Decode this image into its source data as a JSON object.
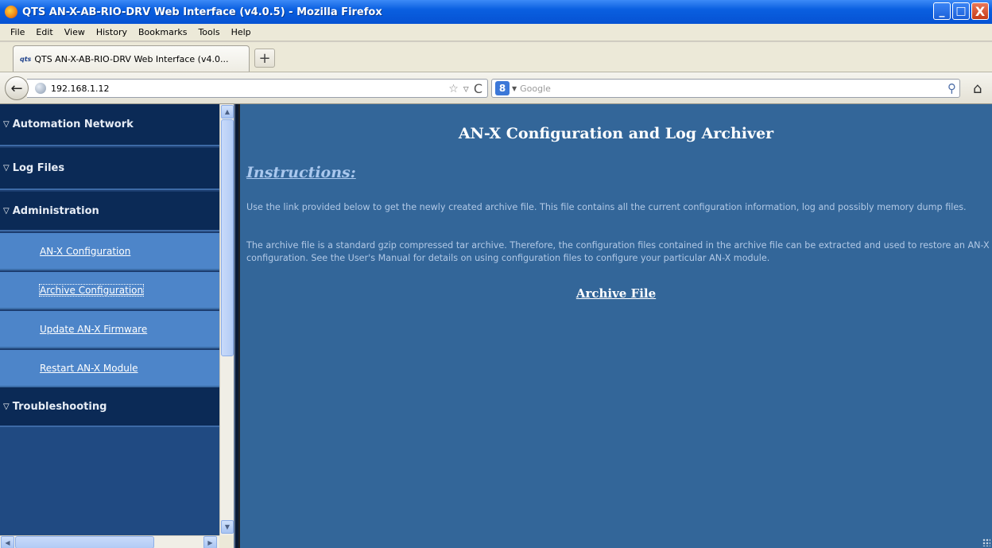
{
  "window": {
    "title": "QTS AN-X-AB-RIO-DRV Web Interface (v4.0.5) - Mozilla Firefox",
    "controls": {
      "minimize": "_",
      "maximize": "□",
      "close": "X"
    }
  },
  "menu": [
    "File",
    "Edit",
    "View",
    "History",
    "Bookmarks",
    "Tools",
    "Help"
  ],
  "tab": {
    "favicon": "qts",
    "label": "QTS AN-X-AB-RIO-DRV Web Interface (v4.0...",
    "new_tab": "+"
  },
  "nav": {
    "back": "←",
    "url": "192.168.1.12",
    "star": "☆",
    "dropdown": "▿",
    "reload": "C",
    "search_engine": "8",
    "search_placeholder": "Google",
    "search_icon": "⚲",
    "home": "⌂"
  },
  "sidebar": {
    "sections": [
      {
        "label": "Automation Network",
        "expanded": true
      },
      {
        "label": "Log Files",
        "expanded": true
      },
      {
        "label": "Administration",
        "expanded": true
      },
      {
        "label": "Troubleshooting",
        "expanded": true
      }
    ],
    "admin_items": [
      {
        "label": "AN-X Configuration"
      },
      {
        "label": "Archive Configuration",
        "focused": true
      },
      {
        "label": "Update AN-X Firmware"
      },
      {
        "label": "Restart AN-X Module"
      }
    ],
    "triangle": "▽"
  },
  "main": {
    "title": "AN-X Configuration and Log Archiver",
    "instructions_heading": "Instructions:",
    "paragraph1": "Use the link provided below to get the newly created archive file. This file contains all the current configuration information, log and possibly memory dump files.",
    "paragraph2": "The archive file is a standard gzip compressed tar archive. Therefore, the configuration files contained in the archive file can be extracted and used to restore an AN-X configuration. See the User's Manual for details on using configuration files to configure your particular AN-X module.",
    "archive_link": "Archive File"
  },
  "colors": {
    "content_bg": "#336699",
    "sidebar_header_bg": "#0b2a56",
    "sidebar_item_bg": "#4d85c9"
  }
}
